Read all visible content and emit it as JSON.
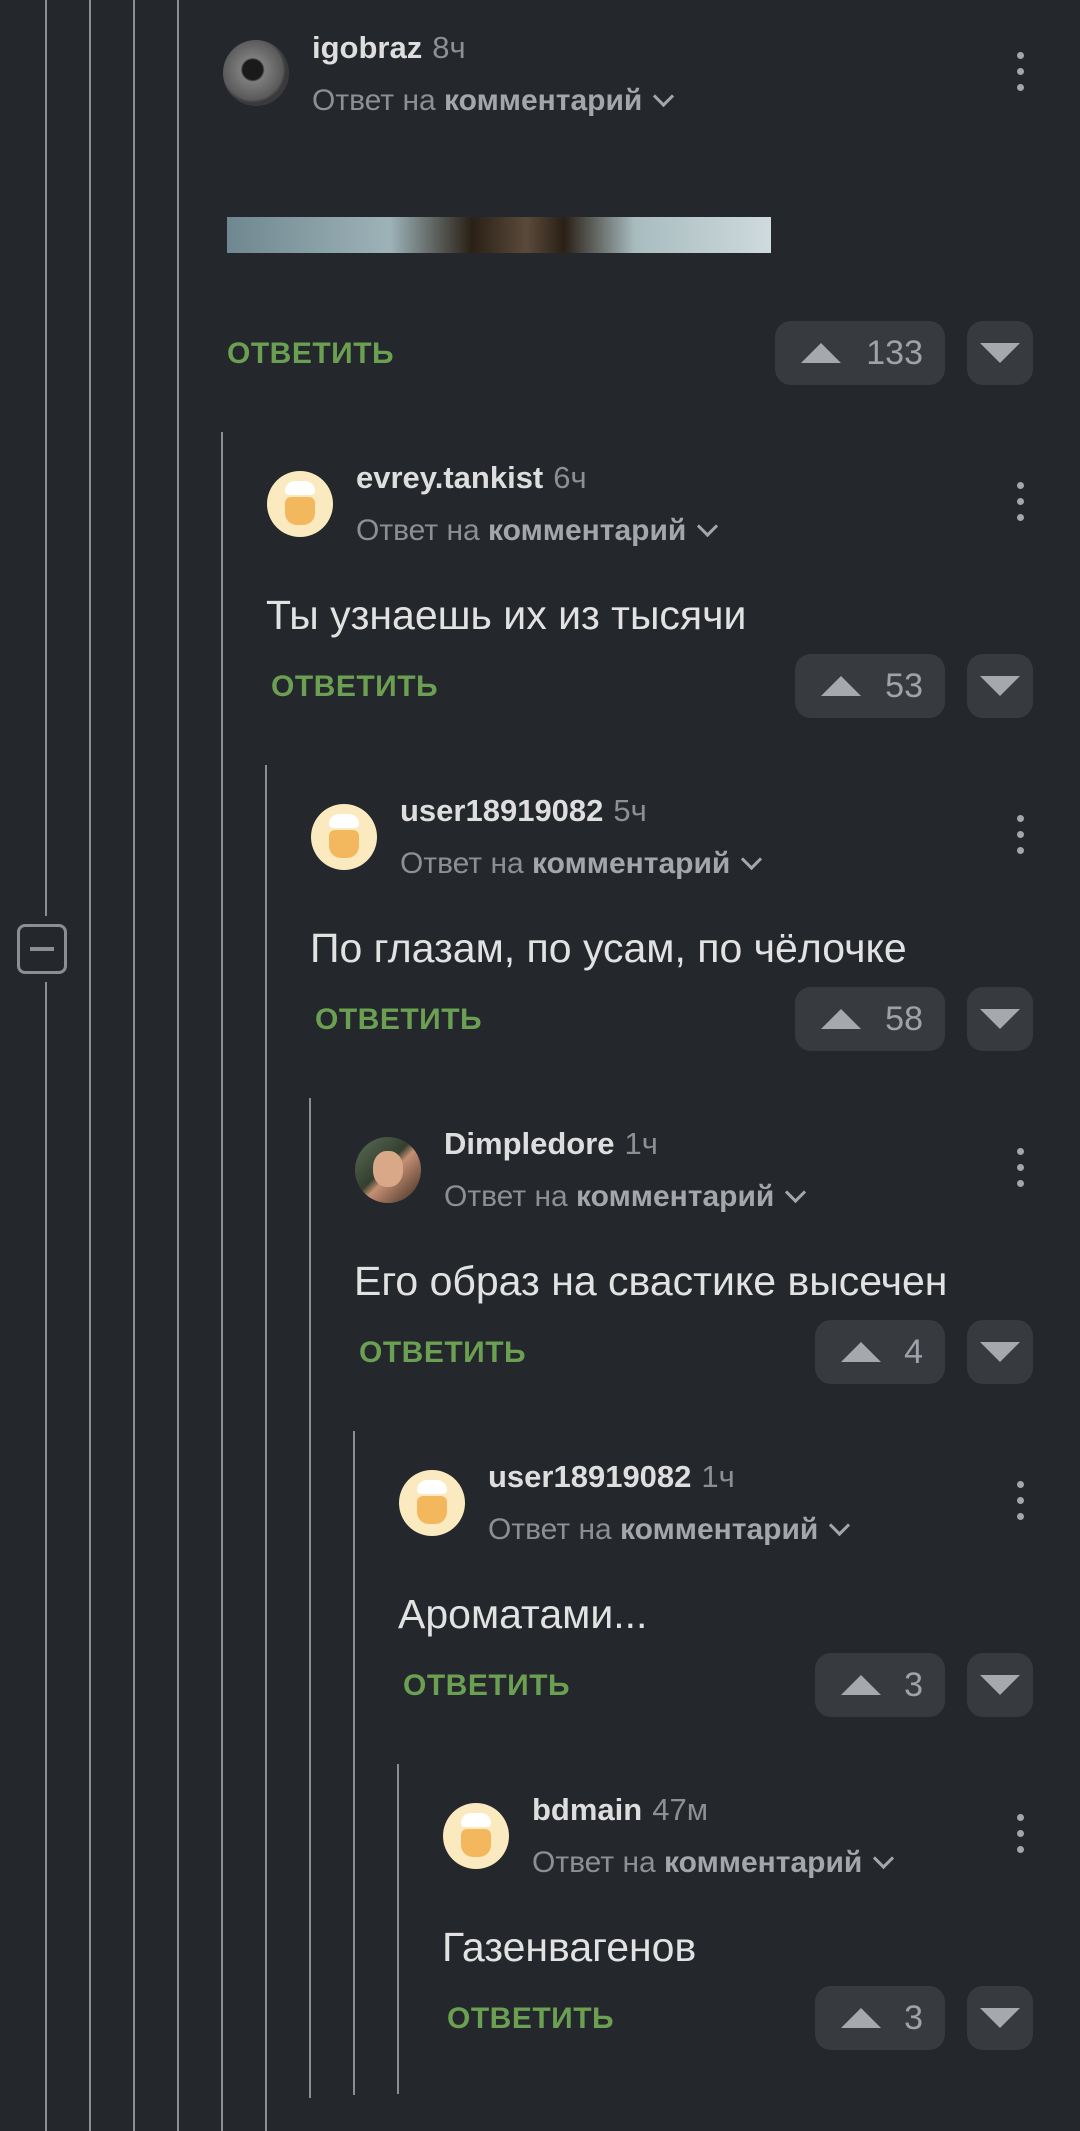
{
  "reply_label": "ОТВЕТИТЬ",
  "comments": [
    {
      "author": "igobraz",
      "time": "8ч",
      "reply_prefix": "Ответ на",
      "reply_target": "комментарий",
      "text": "",
      "votes": "133",
      "avatar": "dark-avatar"
    },
    {
      "author": "evrey.tankist",
      "time": "6ч",
      "reply_prefix": "Ответ на",
      "reply_target": "комментарий",
      "text": "Ты узнаешь их из тысячи",
      "votes": "53",
      "avatar": "default-avatar"
    },
    {
      "author": "user18919082",
      "time": "5ч",
      "reply_prefix": "Ответ на",
      "reply_target": "комментарий",
      "text": "По глазам, по усам, по чёлочке",
      "votes": "58",
      "avatar": "default-avatar"
    },
    {
      "author": "Dimpledore",
      "time": "1ч",
      "reply_prefix": "Ответ на",
      "reply_target": "комментарий",
      "text": "Его образ на свастике высечен",
      "votes": "4",
      "avatar": "photo-avatar"
    },
    {
      "author": "user18919082",
      "time": "1ч",
      "reply_prefix": "Ответ на",
      "reply_target": "комментарий",
      "text": "Ароматами...",
      "votes": "3",
      "avatar": "default-avatar"
    },
    {
      "author": "bdmain",
      "time": "47м",
      "reply_prefix": "Ответ на",
      "reply_target": "комментарий",
      "text": "Газенвагенов",
      "votes": "3",
      "avatar": "default-avatar"
    }
  ],
  "colors": {
    "background": "#24272b",
    "accent": "#6b9f52",
    "button": "#373b40"
  }
}
